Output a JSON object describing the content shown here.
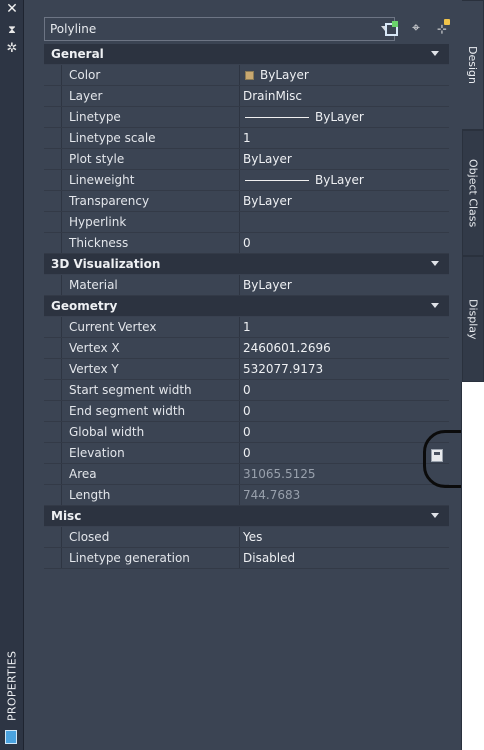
{
  "palette": {
    "title": "PROPERTIES"
  },
  "selector": {
    "value": "Polyline"
  },
  "toolbar": {
    "quick_select_icon": "quick-select-icon",
    "select_objects_icon": "select-objects-icon",
    "toggle_pickadd_icon": "toggle-pickadd-icon"
  },
  "sections": {
    "general": {
      "label": "General",
      "rows": {
        "color": {
          "name": "Color",
          "value": "ByLayer",
          "swatch": "#c8a870"
        },
        "layer": {
          "name": "Layer",
          "value": "DrainMisc"
        },
        "linetype": {
          "name": "Linetype",
          "value": "ByLayer"
        },
        "linetype_scale": {
          "name": "Linetype scale",
          "value": "1"
        },
        "plot_style": {
          "name": "Plot style",
          "value": "ByLayer"
        },
        "lineweight": {
          "name": "Lineweight",
          "value": "ByLayer"
        },
        "transparency": {
          "name": "Transparency",
          "value": "ByLayer"
        },
        "hyperlink": {
          "name": "Hyperlink",
          "value": ""
        },
        "thickness": {
          "name": "Thickness",
          "value": "0"
        }
      }
    },
    "visualization": {
      "label": "3D Visualization",
      "rows": {
        "material": {
          "name": "Material",
          "value": "ByLayer"
        }
      }
    },
    "geometry": {
      "label": "Geometry",
      "rows": {
        "current_vertex": {
          "name": "Current Vertex",
          "value": "1"
        },
        "vertex_x": {
          "name": "Vertex X",
          "value": "2460601.2696"
        },
        "vertex_y": {
          "name": "Vertex Y",
          "value": "532077.9173"
        },
        "start_width": {
          "name": "Start segment width",
          "value": "0"
        },
        "end_width": {
          "name": "End segment width",
          "value": "0"
        },
        "global_width": {
          "name": "Global width",
          "value": "0"
        },
        "elevation": {
          "name": "Elevation",
          "value": "0"
        },
        "area": {
          "name": "Area",
          "value": "31065.5125"
        },
        "length": {
          "name": "Length",
          "value": "744.7683"
        }
      }
    },
    "misc": {
      "label": "Misc",
      "rows": {
        "closed": {
          "name": "Closed",
          "value": "Yes"
        },
        "linetype_generation": {
          "name": "Linetype generation",
          "value": "Disabled"
        }
      }
    }
  },
  "tabs": {
    "design": "Design",
    "object_class": "Object Class",
    "display": "Display"
  }
}
